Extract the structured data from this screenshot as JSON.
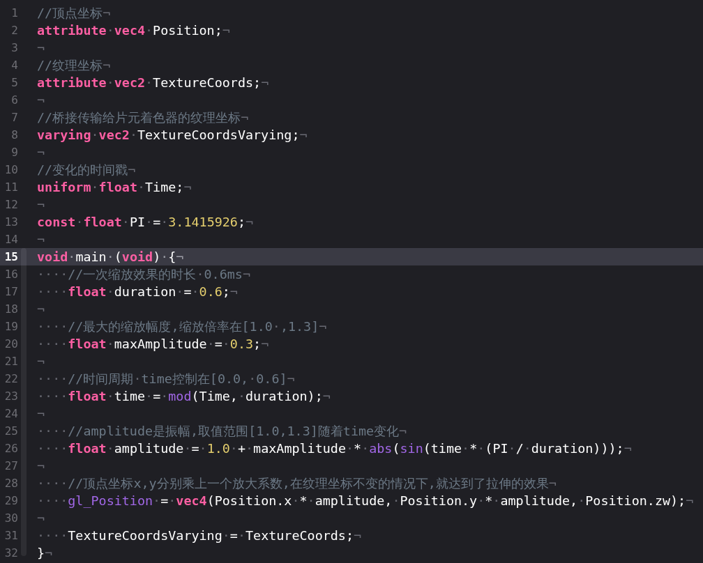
{
  "lines": [
    {
      "number": "1",
      "current": false,
      "tokens": [
        {
          "kind": "comment",
          "text": "//顶点坐标"
        },
        {
          "kind": "invisible",
          "text": "¬"
        }
      ]
    },
    {
      "number": "2",
      "current": false,
      "tokens": [
        {
          "kind": "keyword",
          "text": "attribute"
        },
        {
          "kind": "invisible",
          "text": "·"
        },
        {
          "kind": "keyword",
          "text": "vec4"
        },
        {
          "kind": "invisible",
          "text": "·"
        },
        {
          "kind": "plain",
          "text": "Position;"
        },
        {
          "kind": "invisible",
          "text": "¬"
        }
      ]
    },
    {
      "number": "3",
      "current": false,
      "tokens": [
        {
          "kind": "invisible",
          "text": "¬"
        }
      ]
    },
    {
      "number": "4",
      "current": false,
      "tokens": [
        {
          "kind": "comment",
          "text": "//纹理坐标"
        },
        {
          "kind": "invisible",
          "text": "¬"
        }
      ]
    },
    {
      "number": "5",
      "current": false,
      "tokens": [
        {
          "kind": "keyword",
          "text": "attribute"
        },
        {
          "kind": "invisible",
          "text": "·"
        },
        {
          "kind": "keyword",
          "text": "vec2"
        },
        {
          "kind": "invisible",
          "text": "·"
        },
        {
          "kind": "plain",
          "text": "TextureCoords;"
        },
        {
          "kind": "invisible",
          "text": "¬"
        }
      ]
    },
    {
      "number": "6",
      "current": false,
      "tokens": [
        {
          "kind": "invisible",
          "text": "¬"
        }
      ]
    },
    {
      "number": "7",
      "current": false,
      "tokens": [
        {
          "kind": "comment",
          "text": "//桥接传输给片元着色器的纹理坐标"
        },
        {
          "kind": "invisible",
          "text": "¬"
        }
      ]
    },
    {
      "number": "8",
      "current": false,
      "tokens": [
        {
          "kind": "keyword",
          "text": "varying"
        },
        {
          "kind": "invisible",
          "text": "·"
        },
        {
          "kind": "keyword",
          "text": "vec2"
        },
        {
          "kind": "invisible",
          "text": "·"
        },
        {
          "kind": "plain",
          "text": "TextureCoordsVarying;"
        },
        {
          "kind": "invisible",
          "text": "¬"
        }
      ]
    },
    {
      "number": "9",
      "current": false,
      "tokens": [
        {
          "kind": "invisible",
          "text": "¬"
        }
      ]
    },
    {
      "number": "10",
      "current": false,
      "tokens": [
        {
          "kind": "comment",
          "text": "//变化的时间戳"
        },
        {
          "kind": "invisible",
          "text": "¬"
        }
      ]
    },
    {
      "number": "11",
      "current": false,
      "tokens": [
        {
          "kind": "keyword",
          "text": "uniform"
        },
        {
          "kind": "invisible",
          "text": "·"
        },
        {
          "kind": "keyword",
          "text": "float"
        },
        {
          "kind": "invisible",
          "text": "·"
        },
        {
          "kind": "plain",
          "text": "Time;"
        },
        {
          "kind": "invisible",
          "text": "¬"
        }
      ]
    },
    {
      "number": "12",
      "current": false,
      "tokens": [
        {
          "kind": "invisible",
          "text": "¬"
        }
      ]
    },
    {
      "number": "13",
      "current": false,
      "tokens": [
        {
          "kind": "keyword",
          "text": "const"
        },
        {
          "kind": "invisible",
          "text": "·"
        },
        {
          "kind": "keyword",
          "text": "float"
        },
        {
          "kind": "invisible",
          "text": "·"
        },
        {
          "kind": "plain",
          "text": "PI"
        },
        {
          "kind": "invisible",
          "text": "·"
        },
        {
          "kind": "plain",
          "text": "="
        },
        {
          "kind": "invisible",
          "text": "·"
        },
        {
          "kind": "number",
          "text": "3.1415926"
        },
        {
          "kind": "plain",
          "text": ";"
        },
        {
          "kind": "invisible",
          "text": "¬"
        }
      ]
    },
    {
      "number": "14",
      "current": false,
      "tokens": [
        {
          "kind": "invisible",
          "text": "¬"
        }
      ]
    },
    {
      "number": "15",
      "current": true,
      "tokens": [
        {
          "kind": "keyword",
          "text": "void"
        },
        {
          "kind": "invisible",
          "text": "·"
        },
        {
          "kind": "plain",
          "text": "main"
        },
        {
          "kind": "invisible",
          "text": "·"
        },
        {
          "kind": "plain",
          "text": "("
        },
        {
          "kind": "keyword",
          "text": "void"
        },
        {
          "kind": "plain",
          "text": ")"
        },
        {
          "kind": "invisible",
          "text": "·"
        },
        {
          "kind": "plain",
          "text": "{"
        },
        {
          "kind": "invisible",
          "text": "¬"
        }
      ]
    },
    {
      "number": "16",
      "current": false,
      "tokens": [
        {
          "kind": "invisible",
          "text": "····"
        },
        {
          "kind": "comment",
          "text": "//一次缩放效果的时长"
        },
        {
          "kind": "invisible",
          "text": "·"
        },
        {
          "kind": "comment",
          "text": "0.6ms"
        },
        {
          "kind": "invisible",
          "text": "¬"
        }
      ]
    },
    {
      "number": "17",
      "current": false,
      "tokens": [
        {
          "kind": "invisible",
          "text": "····"
        },
        {
          "kind": "keyword",
          "text": "float"
        },
        {
          "kind": "invisible",
          "text": "·"
        },
        {
          "kind": "plain",
          "text": "duration"
        },
        {
          "kind": "invisible",
          "text": "·"
        },
        {
          "kind": "plain",
          "text": "="
        },
        {
          "kind": "invisible",
          "text": "·"
        },
        {
          "kind": "number",
          "text": "0.6"
        },
        {
          "kind": "plain",
          "text": ";"
        },
        {
          "kind": "invisible",
          "text": "¬"
        }
      ]
    },
    {
      "number": "18",
      "current": false,
      "tokens": [
        {
          "kind": "invisible",
          "text": "¬"
        }
      ]
    },
    {
      "number": "19",
      "current": false,
      "tokens": [
        {
          "kind": "invisible",
          "text": "····"
        },
        {
          "kind": "comment",
          "text": "//最大的缩放幅度,缩放倍率在[1.0"
        },
        {
          "kind": "invisible",
          "text": "·"
        },
        {
          "kind": "comment",
          "text": ",1.3]"
        },
        {
          "kind": "invisible",
          "text": "¬"
        }
      ]
    },
    {
      "number": "20",
      "current": false,
      "tokens": [
        {
          "kind": "invisible",
          "text": "····"
        },
        {
          "kind": "keyword",
          "text": "float"
        },
        {
          "kind": "invisible",
          "text": "·"
        },
        {
          "kind": "plain",
          "text": "maxAmplitude"
        },
        {
          "kind": "invisible",
          "text": "·"
        },
        {
          "kind": "plain",
          "text": "="
        },
        {
          "kind": "invisible",
          "text": "·"
        },
        {
          "kind": "number",
          "text": "0.3"
        },
        {
          "kind": "plain",
          "text": ";"
        },
        {
          "kind": "invisible",
          "text": "¬"
        }
      ]
    },
    {
      "number": "21",
      "current": false,
      "tokens": [
        {
          "kind": "invisible",
          "text": "¬"
        }
      ]
    },
    {
      "number": "22",
      "current": false,
      "tokens": [
        {
          "kind": "invisible",
          "text": "····"
        },
        {
          "kind": "comment",
          "text": "//时间周期"
        },
        {
          "kind": "invisible",
          "text": "·"
        },
        {
          "kind": "comment",
          "text": "time控制在[0.0,"
        },
        {
          "kind": "invisible",
          "text": "·"
        },
        {
          "kind": "comment",
          "text": "0.6]"
        },
        {
          "kind": "invisible",
          "text": "¬"
        }
      ]
    },
    {
      "number": "23",
      "current": false,
      "tokens": [
        {
          "kind": "invisible",
          "text": "····"
        },
        {
          "kind": "keyword",
          "text": "float"
        },
        {
          "kind": "invisible",
          "text": "·"
        },
        {
          "kind": "plain",
          "text": "time"
        },
        {
          "kind": "invisible",
          "text": "·"
        },
        {
          "kind": "plain",
          "text": "="
        },
        {
          "kind": "invisible",
          "text": "·"
        },
        {
          "kind": "function",
          "text": "mod"
        },
        {
          "kind": "plain",
          "text": "(Time,"
        },
        {
          "kind": "invisible",
          "text": "·"
        },
        {
          "kind": "plain",
          "text": "duration);"
        },
        {
          "kind": "invisible",
          "text": "¬"
        }
      ]
    },
    {
      "number": "24",
      "current": false,
      "tokens": [
        {
          "kind": "invisible",
          "text": "¬"
        }
      ]
    },
    {
      "number": "25",
      "current": false,
      "tokens": [
        {
          "kind": "invisible",
          "text": "····"
        },
        {
          "kind": "comment",
          "text": "//amplitude是振幅,取值范围[1.0,1.3]随着time变化"
        },
        {
          "kind": "invisible",
          "text": "¬"
        }
      ]
    },
    {
      "number": "26",
      "current": false,
      "tokens": [
        {
          "kind": "invisible",
          "text": "····"
        },
        {
          "kind": "keyword",
          "text": "float"
        },
        {
          "kind": "invisible",
          "text": "·"
        },
        {
          "kind": "plain",
          "text": "amplitude"
        },
        {
          "kind": "invisible",
          "text": "·"
        },
        {
          "kind": "plain",
          "text": "="
        },
        {
          "kind": "invisible",
          "text": "·"
        },
        {
          "kind": "number",
          "text": "1.0"
        },
        {
          "kind": "invisible",
          "text": "·"
        },
        {
          "kind": "plain",
          "text": "+"
        },
        {
          "kind": "invisible",
          "text": "·"
        },
        {
          "kind": "plain",
          "text": "maxAmplitude"
        },
        {
          "kind": "invisible",
          "text": "·"
        },
        {
          "kind": "plain",
          "text": "*"
        },
        {
          "kind": "invisible",
          "text": "·"
        },
        {
          "kind": "function",
          "text": "abs"
        },
        {
          "kind": "plain",
          "text": "("
        },
        {
          "kind": "function",
          "text": "sin"
        },
        {
          "kind": "plain",
          "text": "(time"
        },
        {
          "kind": "invisible",
          "text": "·"
        },
        {
          "kind": "plain",
          "text": "*"
        },
        {
          "kind": "invisible",
          "text": "·"
        },
        {
          "kind": "plain",
          "text": "(PI"
        },
        {
          "kind": "invisible",
          "text": "·"
        },
        {
          "kind": "plain",
          "text": "/"
        },
        {
          "kind": "invisible",
          "text": "·"
        },
        {
          "kind": "plain",
          "text": "duration)));"
        },
        {
          "kind": "invisible",
          "text": "¬"
        }
      ]
    },
    {
      "number": "27",
      "current": false,
      "tokens": [
        {
          "kind": "invisible",
          "text": "¬"
        }
      ]
    },
    {
      "number": "28",
      "current": false,
      "tokens": [
        {
          "kind": "invisible",
          "text": "····"
        },
        {
          "kind": "comment",
          "text": "//顶点坐标x,y分别乘上一个放大系数,在纹理坐标不变的情况下,就达到了拉伸的效果"
        },
        {
          "kind": "invisible",
          "text": "¬"
        }
      ]
    },
    {
      "number": "29",
      "current": false,
      "tokens": [
        {
          "kind": "invisible",
          "text": "····"
        },
        {
          "kind": "function",
          "text": "gl_Position"
        },
        {
          "kind": "invisible",
          "text": "·"
        },
        {
          "kind": "plain",
          "text": "="
        },
        {
          "kind": "invisible",
          "text": "·"
        },
        {
          "kind": "keyword",
          "text": "vec4"
        },
        {
          "kind": "plain",
          "text": "(Position.x"
        },
        {
          "kind": "invisible",
          "text": "·"
        },
        {
          "kind": "plain",
          "text": "*"
        },
        {
          "kind": "invisible",
          "text": "·"
        },
        {
          "kind": "plain",
          "text": "amplitude,"
        },
        {
          "kind": "invisible",
          "text": "·"
        },
        {
          "kind": "plain",
          "text": "Position.y"
        },
        {
          "kind": "invisible",
          "text": "·"
        },
        {
          "kind": "plain",
          "text": "*"
        },
        {
          "kind": "invisible",
          "text": "·"
        },
        {
          "kind": "plain",
          "text": "amplitude,"
        },
        {
          "kind": "invisible",
          "text": "·"
        },
        {
          "kind": "plain",
          "text": "Position.zw);"
        },
        {
          "kind": "invisible",
          "text": "¬"
        }
      ]
    },
    {
      "number": "30",
      "current": false,
      "tokens": [
        {
          "kind": "invisible",
          "text": "¬"
        }
      ]
    },
    {
      "number": "31",
      "current": false,
      "tokens": [
        {
          "kind": "invisible",
          "text": "····"
        },
        {
          "kind": "plain",
          "text": "TextureCoordsVarying"
        },
        {
          "kind": "invisible",
          "text": "·"
        },
        {
          "kind": "plain",
          "text": "="
        },
        {
          "kind": "invisible",
          "text": "·"
        },
        {
          "kind": "plain",
          "text": "TextureCoords;"
        },
        {
          "kind": "invisible",
          "text": "¬"
        }
      ]
    },
    {
      "number": "32",
      "current": false,
      "tokens": [
        {
          "kind": "plain",
          "text": "}"
        },
        {
          "kind": "invisible",
          "text": "¬"
        }
      ]
    }
  ]
}
